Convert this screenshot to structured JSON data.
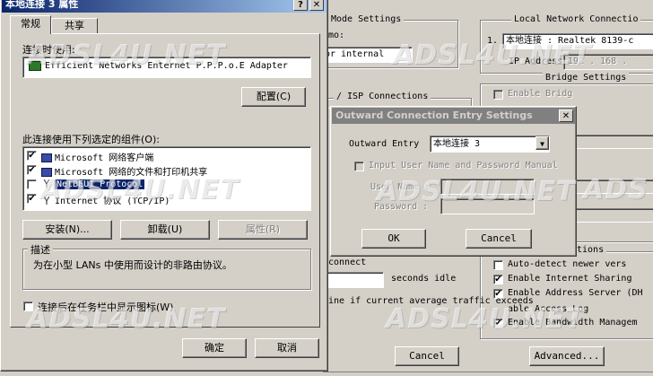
{
  "colors": {
    "face": "#d4d0c8",
    "titlebar_inactive": "#808080",
    "titlebar_active": "#0a246a",
    "selection": "#0a246a"
  },
  "watermark": "ADSL4U.NET",
  "back_window": {
    "mode_settings_label": "Mode Settings",
    "mode_label": "mo:",
    "internal_value": "or internal",
    "isp_connections_label": "/ ISP  Connections",
    "local_network_label": "Local Network  Connectio",
    "adapter_index": "1.",
    "adapter_value": "本地连接 : Realtek 8139-c",
    "ip_address_label": "IP Address",
    "ip_address_value": "192 . 168 .",
    "bridge_settings_label": "Bridge Settings",
    "enable_bridge_label": "Enable Bridg",
    "options_label": "tions",
    "disconnect_label": "connect",
    "seconds_idle_label": "seconds idle",
    "traffic_label": "ine if current average traffic exceeds",
    "autodetect_label": "Auto-detect newer vers",
    "internet_sharing_label": "Enable Internet Sharing",
    "address_server_label": "Enable Address Server (DH",
    "access_log_label": "able Access Log",
    "bandwidth_label": "Enable Bandwidth Managem",
    "cancel_label": "Cancel",
    "advanced_label": "Advanced..."
  },
  "props_window": {
    "title": "本地连接 3 属性",
    "help_button": "?",
    "close_button": "✕",
    "tabs": [
      "常规",
      "共享"
    ],
    "connect_using_label": "连接时使用:",
    "adapter_name": "Efficient Networks Enternet P.P.P.o.E Adapter",
    "configure_button": "配置(C)",
    "components_label": "此连接使用下列选定的组件(O):",
    "components": [
      {
        "label": "Microsoft 网络客户端",
        "checked": "✔"
      },
      {
        "label": "Microsoft 网络的文件和打印机共享",
        "checked": "✔"
      },
      {
        "label": "NetBEUI Protocol",
        "checked": ""
      },
      {
        "label": "Internet 协议 (TCP/IP)",
        "checked": "✔"
      }
    ],
    "install_button": "安装(N)...",
    "uninstall_button": "卸载(U)",
    "properties_button": "属性(R)",
    "description_label": "描述",
    "description_text": "为在小型 LANs 中使用而设计的非路由协议。",
    "show_icon_label": "连接后在任务栏中显示图标(W)",
    "ok_button": "确定",
    "cancel_button": "取消"
  },
  "entry_dialog": {
    "title": "Outward Connection Entry Settings",
    "close_button": "✕",
    "outward_entry_label": "Outward Entry",
    "outward_entry_value": "本地连接 3",
    "input_user_label": "Input User Name and Password Manual",
    "user_name_label": "User Name :",
    "password_label": "Password :",
    "ok_button": "OK",
    "cancel_button": "Cancel",
    "dropdown_arrow": "▼"
  }
}
